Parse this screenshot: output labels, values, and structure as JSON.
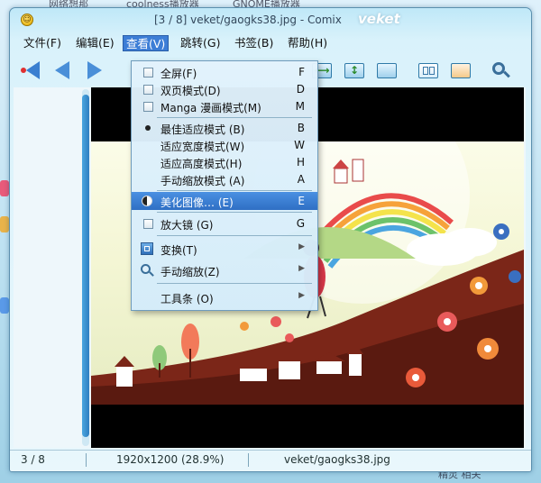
{
  "desktop_texts": [
    "网络想那",
    "coolness播放器",
    "GNOME播放器",
    "精灵 相关"
  ],
  "window": {
    "title": "[3 / 8]  veket/gaogks38.jpg - Comix",
    "brand": "veket"
  },
  "menus": [
    {
      "label": "文件(F)"
    },
    {
      "label": "编辑(E)"
    },
    {
      "label": "查看(V)"
    },
    {
      "label": "跳转(G)"
    },
    {
      "label": "书签(B)"
    },
    {
      "label": "帮助(H)"
    }
  ],
  "view_menu": {
    "items": [
      {
        "kind": "check",
        "label": "全屏(F)",
        "key": "F"
      },
      {
        "kind": "check",
        "label": "双页模式(D)",
        "key": "D"
      },
      {
        "kind": "check",
        "label": "Manga 漫画模式(M)",
        "key": "M"
      },
      {
        "kind": "radio",
        "checked": true,
        "label": "最佳适应模式 (B)",
        "key": "B"
      },
      {
        "kind": "radio",
        "label": "适应宽度模式(W)",
        "key": "W"
      },
      {
        "kind": "radio",
        "label": "适应高度模式(H)",
        "key": "H"
      },
      {
        "kind": "radio",
        "label": "手动缩放模式 (A)",
        "key": "A"
      },
      {
        "kind": "icon",
        "icon": "enhance-icon",
        "label": "美化图像… (E)",
        "key": "E",
        "highlighted": true
      },
      {
        "kind": "check",
        "label": "放大镜 (G)",
        "key": "G"
      },
      {
        "kind": "submenu",
        "icon": "transform-icon",
        "label": "变换(T)"
      },
      {
        "kind": "submenu",
        "icon": "zoom-icon",
        "label": "手动缩放(Z)"
      },
      {
        "kind": "submenu",
        "label": "工具条 (O)"
      }
    ]
  },
  "status": {
    "page": "3 / 8",
    "resolution": "1920x1200 (28.9%)",
    "file": "veket/gaogks38.jpg"
  },
  "colors": {
    "accent": "#3d7ed6",
    "highlight": "#2f6fc4"
  }
}
